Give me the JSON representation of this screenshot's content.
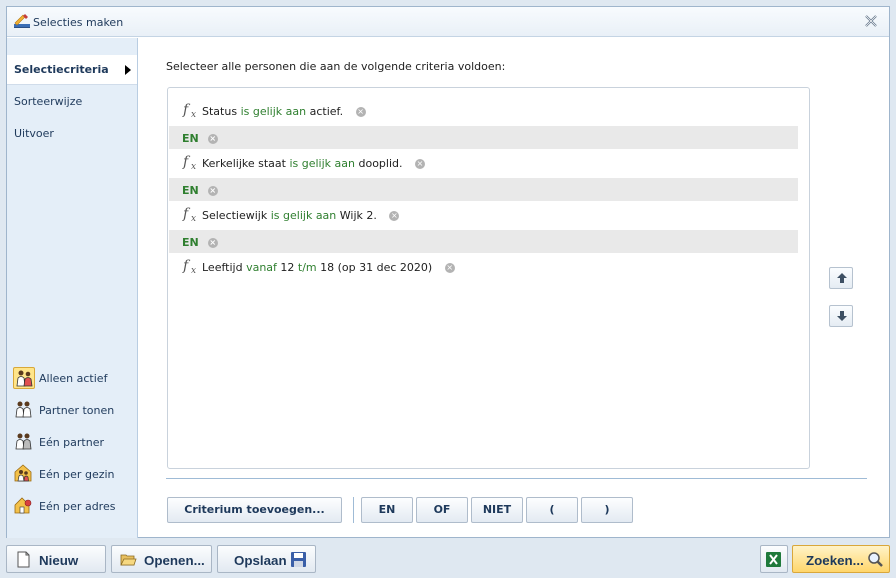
{
  "window": {
    "title": "Selecties maken"
  },
  "sidebar": {
    "nav": [
      {
        "label": "Selectiecriteria",
        "active": true
      },
      {
        "label": "Sorteerwijze",
        "active": false
      },
      {
        "label": "Uitvoer",
        "active": false
      }
    ],
    "options": [
      {
        "label": "Alleen actief",
        "icon": "people-active-icon",
        "selected": true
      },
      {
        "label": "Partner tonen",
        "icon": "people-partner-icon",
        "selected": false
      },
      {
        "label": "Eén partner",
        "icon": "one-partner-icon",
        "selected": false
      },
      {
        "label": "Eén per gezin",
        "icon": "family-icon",
        "selected": false
      },
      {
        "label": "Eén per adres",
        "icon": "address-icon",
        "selected": false
      }
    ]
  },
  "main": {
    "intro": "Selecteer alle personen die aan de volgende criteria voldoen:",
    "criteria": [
      {
        "type": "criterion",
        "field": "Status",
        "op": "is gelijk aan",
        "value": "actief."
      },
      {
        "type": "connector",
        "label": "EN"
      },
      {
        "type": "criterion",
        "field": "Kerkelijke staat",
        "op": "is gelijk aan",
        "value": "dooplid."
      },
      {
        "type": "connector",
        "label": "EN"
      },
      {
        "type": "criterion",
        "field": "Selectiewijk",
        "op": "is gelijk aan",
        "value": "Wijk 2."
      },
      {
        "type": "connector",
        "label": "EN"
      },
      {
        "type": "criterion",
        "field": "Leeftijd",
        "op": "vanaf",
        "value_parts": [
          "12",
          "t/m",
          "18 (op 31 dec 2020)"
        ]
      }
    ],
    "buttons": {
      "add": "Criterium toevoegen...",
      "and": "EN",
      "or": "OF",
      "not": "NIET",
      "open_paren": "(",
      "close_paren": ")"
    }
  },
  "footer": {
    "new": "Nieuw",
    "open": "Openen...",
    "save": "Opslaan",
    "search": "Zoeken..."
  },
  "colors": {
    "keyword": "#2f7f2f",
    "accent": "#1e395b",
    "search_button": "#ffd66b"
  }
}
